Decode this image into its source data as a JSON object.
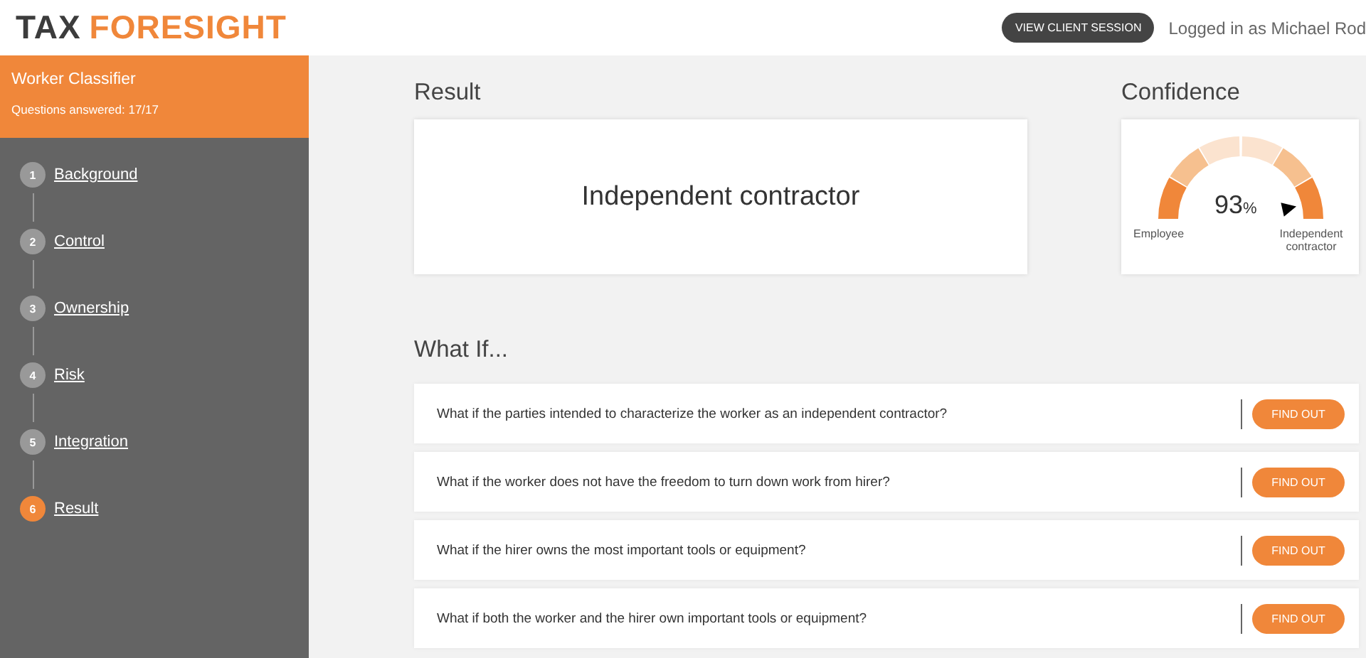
{
  "logo": {
    "first": "TAX",
    "second": "FORESIGHT"
  },
  "header": {
    "button": "VIEW CLIENT SESSION",
    "user": "Logged in as Michael Rod"
  },
  "sidebar": {
    "title": "Worker Classifier",
    "progress": "Questions answered: 17/17",
    "steps": [
      {
        "number": "1",
        "label": "Background",
        "selected": false
      },
      {
        "number": "2",
        "label": "Control",
        "selected": false
      },
      {
        "number": "3",
        "label": "Ownership",
        "selected": false
      },
      {
        "number": "4",
        "label": "Risk",
        "selected": false
      },
      {
        "number": "5",
        "label": "Integration",
        "selected": false
      },
      {
        "number": "6",
        "label": "Result",
        "selected": true
      }
    ]
  },
  "result": {
    "title": "Result",
    "value": "Independent contractor"
  },
  "confidence": {
    "title": "Confidence",
    "reading": "93",
    "unit": "%",
    "left_label": "Employee",
    "right_label": "Independent contractor"
  },
  "what_if": {
    "title": "What If...",
    "questions": [
      {
        "text": "What if the parties intended to characterize the worker as an independent contractor?",
        "button": "FIND OUT"
      },
      {
        "text": "What if the worker does not have the freedom to turn down work from hirer?",
        "button": "FIND OUT"
      },
      {
        "text": "What if the hirer owns the most important tools or equipment?",
        "button": "FIND OUT"
      },
      {
        "text": "What if both the worker and the hirer own important tools or equipment?",
        "button": "FIND OUT"
      }
    ]
  }
}
